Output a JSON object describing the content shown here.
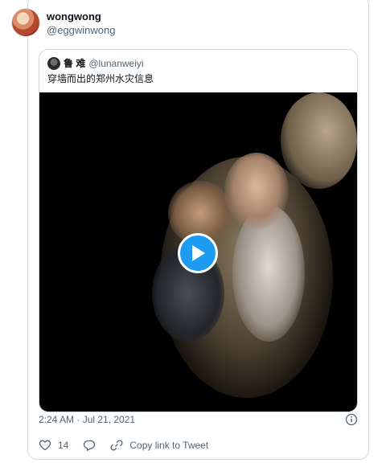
{
  "tweet": {
    "author": {
      "display_name": "wongwong",
      "handle": "@eggwinwong",
      "avatar_icon": "avatar-photo"
    },
    "quoted": {
      "display_name": "鲁 难",
      "handle": "@lunanweiyi",
      "text": "穿墙而出的郑州水灾信息",
      "media": {
        "type": "video",
        "play_icon": "play-icon"
      }
    },
    "timestamp": "2:24 AM · Jul 21, 2021",
    "info_icon": "info-icon",
    "actions": {
      "like_icon": "heart-icon",
      "like_count": "14",
      "reply_icon": "reply-icon",
      "copy_icon": "link-icon",
      "copy_label": "Copy link to Tweet"
    }
  },
  "colors": {
    "accent": "#1d9bf0",
    "secondary_text": "#536471",
    "border": "#cfd9de"
  }
}
